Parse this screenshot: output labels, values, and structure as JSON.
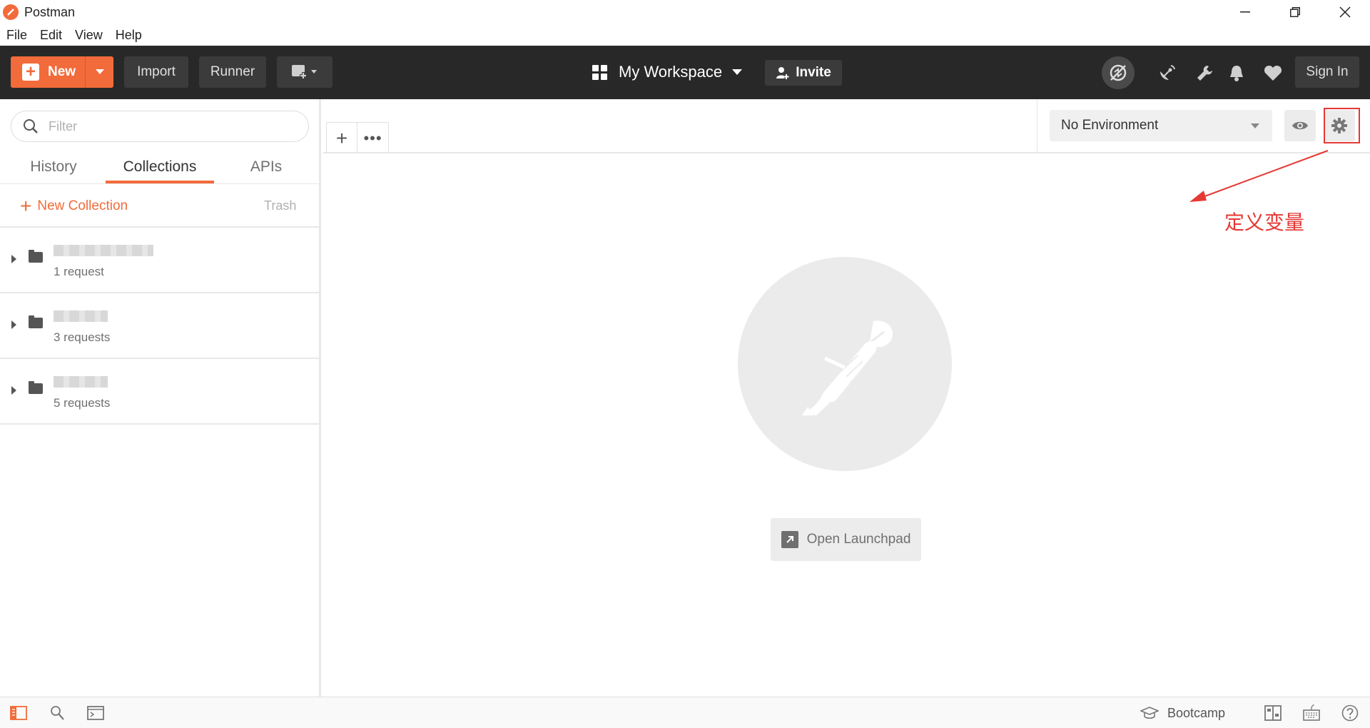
{
  "window": {
    "title": "Postman",
    "minimize": "—",
    "restore": "❐",
    "close": "✕"
  },
  "menu": [
    "File",
    "Edit",
    "View",
    "Help"
  ],
  "header": {
    "new_label": "New",
    "import_label": "Import",
    "runner_label": "Runner",
    "workspace_label": "My Workspace",
    "invite_label": "Invite",
    "signin_label": "Sign In"
  },
  "sidebar": {
    "filter_placeholder": "Filter",
    "tabs": [
      "History",
      "Collections",
      "APIs"
    ],
    "active_tab": "Collections",
    "new_collection_label": "New Collection",
    "trash_label": "Trash",
    "collections": [
      {
        "count": "1 request"
      },
      {
        "count": "3 requests"
      },
      {
        "count": "5 requests"
      }
    ]
  },
  "main": {
    "add_tab": "+",
    "more_tabs": "•••",
    "environment": "No Environment",
    "open_launchpad": "Open Launchpad",
    "annotation": "定义变量"
  },
  "statusbar": {
    "bootcamp_label": "Bootcamp"
  },
  "colors": {
    "accent": "#f26b3a",
    "header_bg": "#282828",
    "annotation": "#e53935"
  }
}
